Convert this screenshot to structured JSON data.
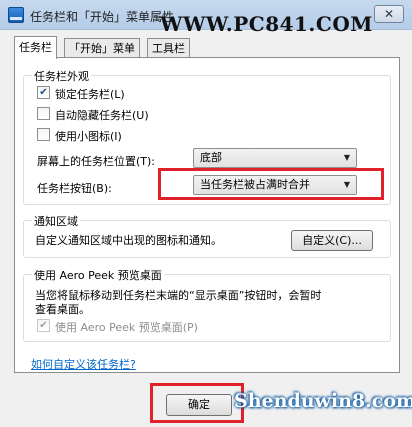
{
  "window": {
    "title": "任务栏和「开始」菜单属性",
    "close_label": "✕"
  },
  "watermarks": {
    "top": "WWW.PC841.COM",
    "bottom": "Shenduwin8.com"
  },
  "tabs": [
    {
      "label": "任务栏",
      "active": true
    },
    {
      "label": "「开始」菜单",
      "active": false
    },
    {
      "label": "工具栏",
      "active": false
    }
  ],
  "appearance": {
    "title": "任务栏外观",
    "lock": {
      "label": "锁定任务栏(L)",
      "checked": true
    },
    "autohide": {
      "label": "自动隐藏任务栏(U)",
      "checked": false
    },
    "small_icons": {
      "label": "使用小图标(I)",
      "checked": false
    },
    "location": {
      "label": "屏幕上的任务栏位置(T):",
      "value": "底部"
    },
    "buttons": {
      "label": "任务栏按钮(B):",
      "value": "当任务栏被占满时合并"
    }
  },
  "notification": {
    "title": "通知区域",
    "description": "自定义通知区域中出现的图标和通知。",
    "customize_button": "自定义(C)..."
  },
  "aero_peek": {
    "title": "使用 Aero Peek 预览桌面",
    "description_line1": "当您将鼠标移动到任务栏末端的“显示桌面”按钮时，会暂时",
    "description_line2": "查看桌面。",
    "checkbox": {
      "label": "使用 Aero Peek 预览桌面(P)",
      "checked": true,
      "disabled": true
    }
  },
  "help_link": "如何自定义该任务栏?",
  "ok_button": "确定",
  "colors": {
    "highlight": "#e0202a",
    "link": "#0066cc"
  }
}
